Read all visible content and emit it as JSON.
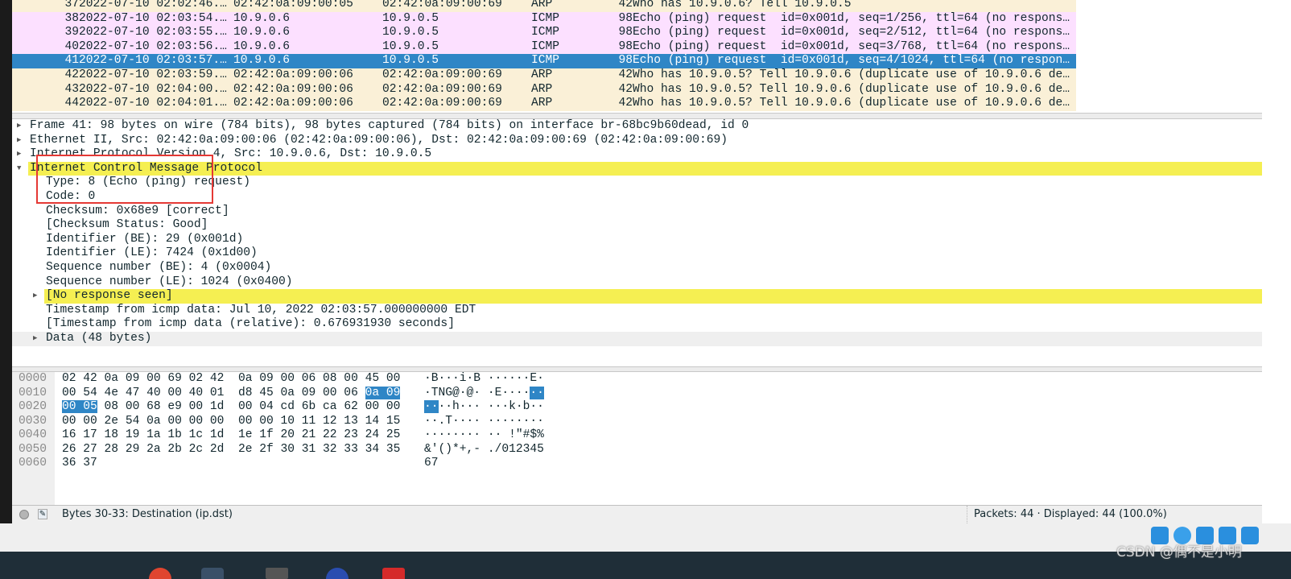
{
  "colors": {
    "arp_row": "#faf0d7",
    "icmp_row": "#fce0ff",
    "selected_row": "#2f86c6",
    "highlight": "#f5ef52"
  },
  "packets": [
    {
      "no": "37",
      "time": "2022-07-10 02:02:46.…",
      "src": "02:42:0a:09:00:05",
      "dst": "02:42:0a:09:00:69",
      "proto": "ARP",
      "len": "42",
      "info": "Who has 10.9.0.6? Tell 10.9.0.5",
      "kind": "arp"
    },
    {
      "no": "38",
      "time": "2022-07-10 02:03:54.…",
      "src": "10.9.0.6",
      "dst": "10.9.0.5",
      "proto": "ICMP",
      "len": "98",
      "info": "Echo (ping) request  id=0x001d, seq=1/256, ttl=64 (no respons…",
      "kind": "icmp"
    },
    {
      "no": "39",
      "time": "2022-07-10 02:03:55.…",
      "src": "10.9.0.6",
      "dst": "10.9.0.5",
      "proto": "ICMP",
      "len": "98",
      "info": "Echo (ping) request  id=0x001d, seq=2/512, ttl=64 (no respons…",
      "kind": "icmp"
    },
    {
      "no": "40",
      "time": "2022-07-10 02:03:56.…",
      "src": "10.9.0.6",
      "dst": "10.9.0.5",
      "proto": "ICMP",
      "len": "98",
      "info": "Echo (ping) request  id=0x001d, seq=3/768, ttl=64 (no respons…",
      "kind": "icmp"
    },
    {
      "no": "41",
      "time": "2022-07-10 02:03:57.…",
      "src": "10.9.0.6",
      "dst": "10.9.0.5",
      "proto": "ICMP",
      "len": "98",
      "info": "Echo (ping) request  id=0x001d, seq=4/1024, ttl=64 (no respon…",
      "kind": "selected"
    },
    {
      "no": "42",
      "time": "2022-07-10 02:03:59.…",
      "src": "02:42:0a:09:00:06",
      "dst": "02:42:0a:09:00:69",
      "proto": "ARP",
      "len": "42",
      "info": "Who has 10.9.0.5? Tell 10.9.0.6 (duplicate use of 10.9.0.6 de…",
      "kind": "arp"
    },
    {
      "no": "43",
      "time": "2022-07-10 02:04:00.…",
      "src": "02:42:0a:09:00:06",
      "dst": "02:42:0a:09:00:69",
      "proto": "ARP",
      "len": "42",
      "info": "Who has 10.9.0.5? Tell 10.9.0.6 (duplicate use of 10.9.0.6 de…",
      "kind": "arp"
    },
    {
      "no": "44",
      "time": "2022-07-10 02:04:01.…",
      "src": "02:42:0a:09:00:06",
      "dst": "02:42:0a:09:00:69",
      "proto": "ARP",
      "len": "42",
      "info": "Who has 10.9.0.5? Tell 10.9.0.6 (duplicate use of 10.9.0.6 de…",
      "kind": "arp"
    }
  ],
  "details": [
    {
      "text": "Frame 41: 98 bytes on wire (784 bits), 98 bytes captured (784 bits) on interface br-68bc9b60dead, id 0",
      "level": 0,
      "expander": "collapsed"
    },
    {
      "text": "Ethernet II, Src: 02:42:0a:09:00:06 (02:42:0a:09:00:06), Dst: 02:42:0a:09:00:69 (02:42:0a:09:00:69)",
      "level": 0,
      "expander": "collapsed"
    },
    {
      "text": "Internet Protocol Version 4, Src: 10.9.0.6, Dst: 10.9.0.5",
      "level": 0,
      "expander": "collapsed"
    },
    {
      "text": "Internet Control Message Protocol",
      "level": 0,
      "expander": "expanded",
      "highlight": true
    },
    {
      "text": "Type: 8 (Echo (ping) request)",
      "level": 1
    },
    {
      "text": "Code: 0",
      "level": 1
    },
    {
      "text": "Checksum: 0x68e9 [correct]",
      "level": 1
    },
    {
      "text": "[Checksum Status: Good]",
      "level": 1
    },
    {
      "text": "Identifier (BE): 29 (0x001d)",
      "level": 1
    },
    {
      "text": "Identifier (LE): 7424 (0x1d00)",
      "level": 1
    },
    {
      "text": "Sequence number (BE): 4 (0x0004)",
      "level": 1
    },
    {
      "text": "Sequence number (LE): 1024 (0x0400)",
      "level": 1
    },
    {
      "text": "[No response seen]",
      "level": 1,
      "expander": "collapsed",
      "highlight": true
    },
    {
      "text": "Timestamp from icmp data: Jul 10, 2022 02:03:57.000000000 EDT",
      "level": 1
    },
    {
      "text": "[Timestamp from icmp data (relative): 0.676931930 seconds]",
      "level": 1
    },
    {
      "text": "Data (48 bytes)",
      "level": 1,
      "expander": "collapsed",
      "gray": true
    }
  ],
  "hex": [
    {
      "off": "0000",
      "pre": "02 42 0a 09 00 69 02 42  0a 09 00 06 08 00 45 00",
      "sel": "",
      "post": "",
      "apre": "·B···i·B ······E·",
      "asel": "",
      "apost": ""
    },
    {
      "off": "0010",
      "pre": "00 54 4e 47 40 00 40 01  d8 45 0a 09 00 06 ",
      "sel": "0a 09",
      "post": "",
      "apre": "·TNG@·@· ·E····",
      "asel": "··",
      "apost": ""
    },
    {
      "off": "0020",
      "pre": "",
      "sel": "00 05",
      "post": " 08 00 68 e9 00 1d  00 04 cd 6b ca 62 00 00",
      "apre": "",
      "asel": "··",
      "apost": "··h··· ···k·b··"
    },
    {
      "off": "0030",
      "pre": "00 00 2e 54 0a 00 00 00  00 00 10 11 12 13 14 15",
      "sel": "",
      "post": "",
      "apre": "··.T···· ········",
      "asel": "",
      "apost": ""
    },
    {
      "off": "0040",
      "pre": "16 17 18 19 1a 1b 1c 1d  1e 1f 20 21 22 23 24 25",
      "sel": "",
      "post": "",
      "apre": "········ ·· !\"#$%",
      "asel": "",
      "apost": ""
    },
    {
      "off": "0050",
      "pre": "26 27 28 29 2a 2b 2c 2d  2e 2f 30 31 32 33 34 35",
      "sel": "",
      "post": "",
      "apre": "&'()*+,- ./012345",
      "asel": "",
      "apost": ""
    },
    {
      "off": "0060",
      "pre": "36 37",
      "sel": "",
      "post": "",
      "apre": "67",
      "asel": "",
      "apost": ""
    }
  ],
  "status": {
    "field_info": "Bytes 30-33: Destination (ip.dst)",
    "packets": "Packets: 44 · Displayed: 44 (100.0%)"
  },
  "watermark": "CSDN @偶不是小明"
}
